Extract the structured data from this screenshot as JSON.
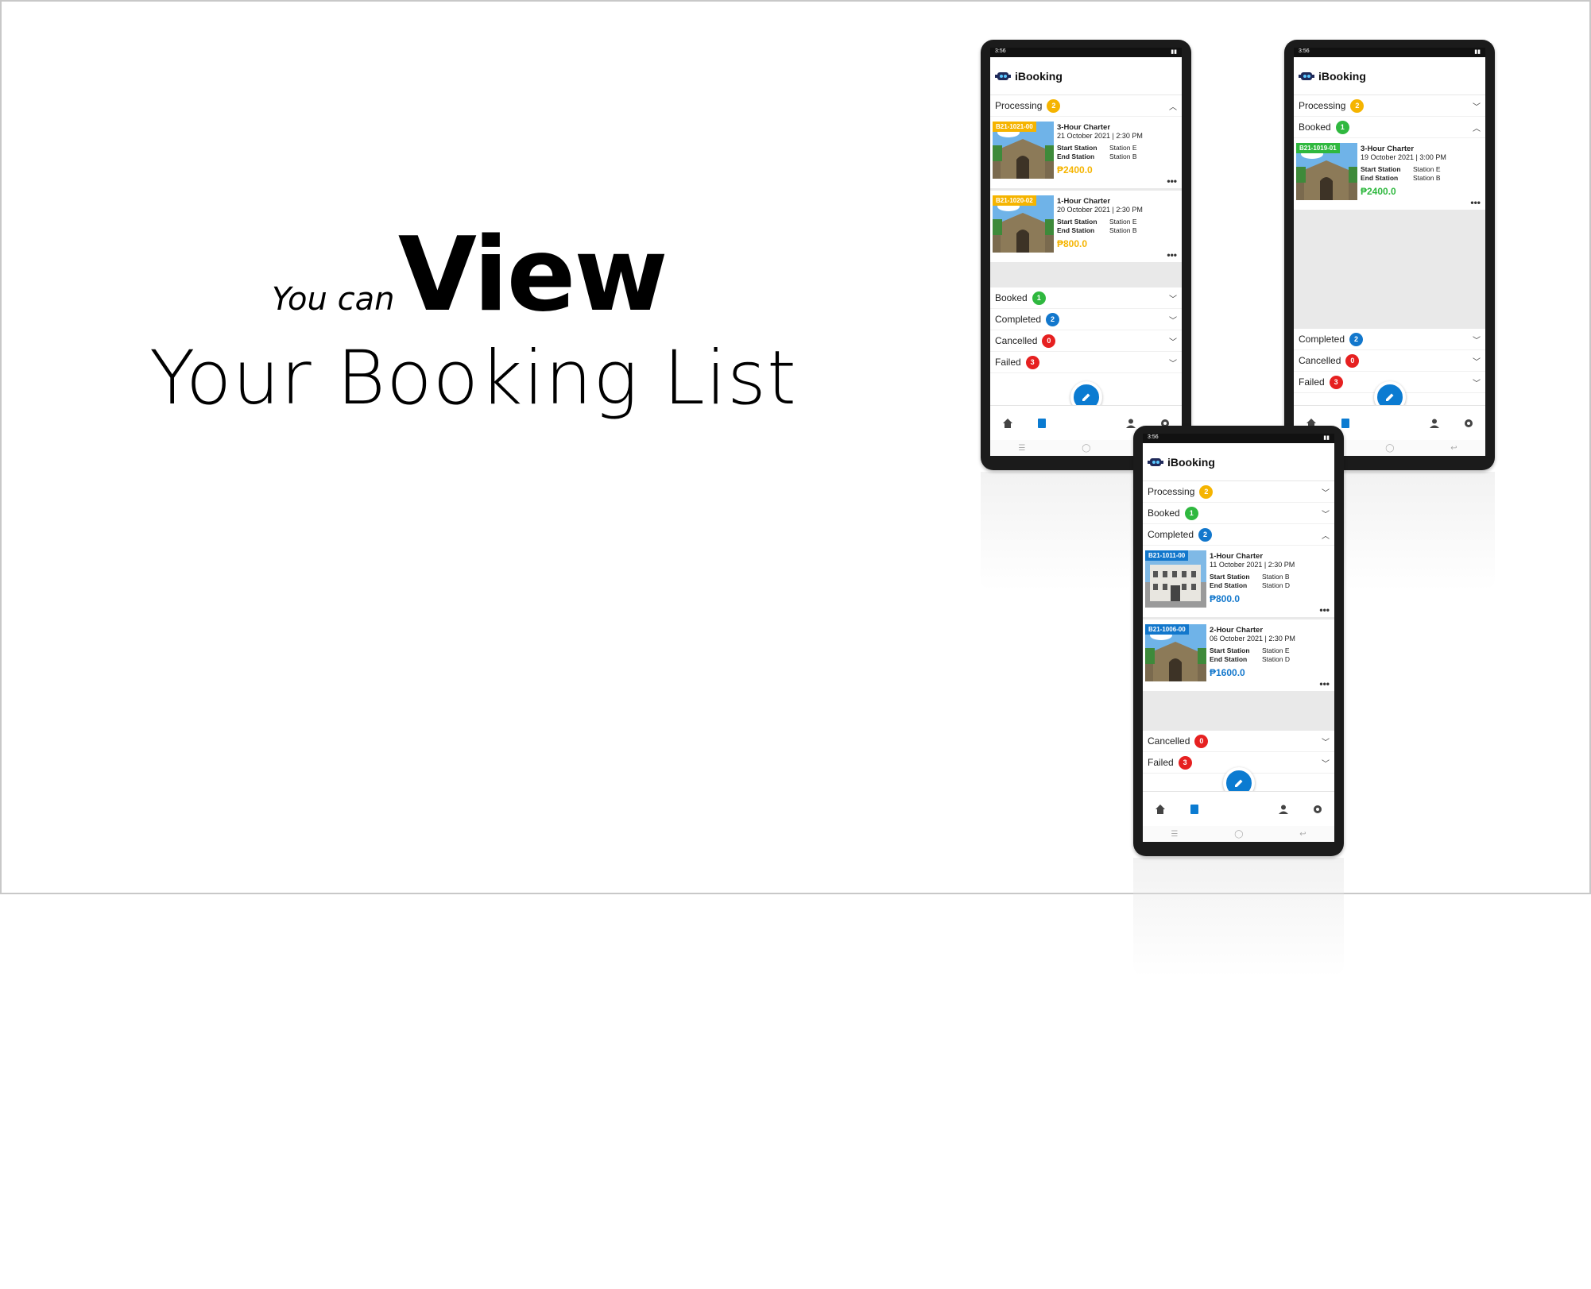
{
  "headline": {
    "prefix": "You can",
    "emphasis": "View",
    "line2": "Your Booking List"
  },
  "app": {
    "status_time": "3:56",
    "title": "iBooking"
  },
  "sections": {
    "processing": "Processing",
    "booked": "Booked",
    "completed": "Completed",
    "cancelled": "Cancelled",
    "failed": "Failed"
  },
  "counts": {
    "processing": "2",
    "booked": "1",
    "completed": "2",
    "cancelled": "0",
    "failed": "3"
  },
  "colors": {
    "processing": "#f5b400",
    "booked": "#2fb83f",
    "completed": "#1277cc",
    "cancelled": "#e62020",
    "failed": "#e62020",
    "fab": "#0b7bd1"
  },
  "labels": {
    "start_station": "Start Station",
    "end_station": "End Station",
    "more": "•••"
  },
  "phone1": {
    "bookings": [
      {
        "id": "B21-1021-00",
        "title": "3-Hour Charter",
        "date": "21 October 2021 | 2:30 PM",
        "start": "Station E",
        "end": "Station B",
        "price": "₱2400.0"
      },
      {
        "id": "B21-1020-02",
        "title": "1-Hour Charter",
        "date": "20 October 2021 | 2:30 PM",
        "start": "Station E",
        "end": "Station B",
        "price": "₱800.0"
      }
    ]
  },
  "phone2": {
    "bookings": [
      {
        "id": "B21-1019-01",
        "title": "3-Hour Charter",
        "date": "19 October 2021 | 3:00 PM",
        "start": "Station E",
        "end": "Station B",
        "price": "₱2400.0"
      }
    ]
  },
  "phone3": {
    "bookings": [
      {
        "id": "B21-1011-00",
        "title": "1-Hour Charter",
        "date": "11 October 2021 | 2:30 PM",
        "start": "Station B",
        "end": "Station D",
        "price": "₱800.0"
      },
      {
        "id": "B21-1006-00",
        "title": "2-Hour Charter",
        "date": "06 October 2021 | 2:30 PM",
        "start": "Station E",
        "end": "Station D",
        "price": "₱1600.0"
      }
    ]
  }
}
